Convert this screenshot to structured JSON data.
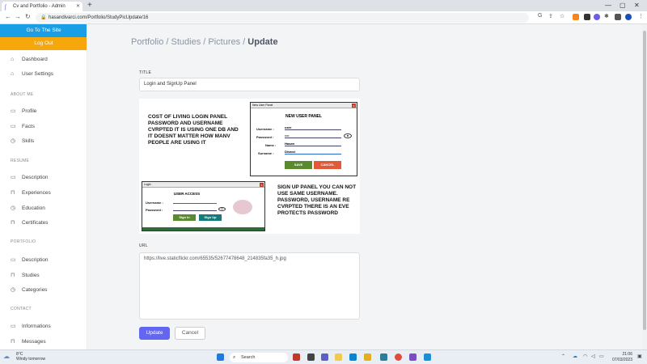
{
  "browser": {
    "tab_title": "Cv and Portfolio - Admin",
    "url": "hasandivarci.com/Portfolio/StudyPicUpdate/16"
  },
  "sidebar": {
    "go_site": "Go To The Site",
    "logout": "Log Out",
    "items_top": [
      {
        "label": "Dashboard",
        "icon": "home-icon"
      },
      {
        "label": "User Settings",
        "icon": "home-icon"
      }
    ],
    "about_head": "ABOUT ME",
    "about_items": [
      {
        "label": "Profile",
        "icon": "calendar-icon"
      },
      {
        "label": "Facts",
        "icon": "calendar-icon"
      },
      {
        "label": "Skills",
        "icon": "clock-icon"
      }
    ],
    "resume_head": "RESUME",
    "resume_items": [
      {
        "label": "Description",
        "icon": "calendar-icon"
      },
      {
        "label": "Experiences",
        "icon": "lock-icon"
      },
      {
        "label": "Education",
        "icon": "clock-icon"
      },
      {
        "label": "Certificates",
        "icon": "lock-icon"
      }
    ],
    "portfolio_head": "PORTFOLIO",
    "portfolio_items": [
      {
        "label": "Description",
        "icon": "calendar-icon"
      },
      {
        "label": "Studies",
        "icon": "lock-icon"
      },
      {
        "label": "Categories",
        "icon": "clock-icon"
      }
    ],
    "contact_head": "CONTACT",
    "contact_items": [
      {
        "label": "Informations",
        "icon": "calendar-icon"
      },
      {
        "label": "Messages",
        "icon": "lock-icon"
      }
    ]
  },
  "breadcrumb": {
    "path": "Portfolio / Studies / Pictures / ",
    "current": "Update"
  },
  "form": {
    "title_label": "TITLE",
    "title_value": "Login and SignUp Panel",
    "url_label": "URL",
    "url_value": "https://live.staticflickr.com/65535/52677478648_214835fa35_h.jpg",
    "update_label": "Update",
    "cancel_label": "Cancel"
  },
  "picture": {
    "text_top": "COST OF LIVING LOGIN PANEL PASSWORD AND USERNAME CVRPTED IT IS USING ONE DB AND IT DOESNT MATTER HOW MANV PEOPLE ARE USING IT",
    "text_bottom": "SIGN UP PANEL YOU CAN NOT USE SAME USERNAME. PASSWORD, USERNAME RE CVRPTED THERE IS AN EVE PROTECTS PASSWORD",
    "newuser_window_title": "New User Panel",
    "newuser_heading": "NEW USER PANEL",
    "nu_username_label": "Username :",
    "nu_username_value": "user",
    "nu_password_label": "Password :",
    "nu_password_value": "••••",
    "nu_name_label": "Name :",
    "nu_name_value": "Hasan",
    "nu_surname_label": "Surname :",
    "nu_surname_value": "Divarci",
    "nu_save": "SAVE",
    "nu_cancel": "CANCEL",
    "login_window_title": "Login",
    "login_heading": "USER ACCESS",
    "lg_username_label": "Username :",
    "lg_password_label": "Password :",
    "lg_signin": "Sign In",
    "lg_signup": "Sign Up"
  },
  "taskbar": {
    "weather_temp": "8°C",
    "weather_desc": "Windy tomorrow",
    "search": "Search",
    "time": "21:06",
    "date": "07/03/2023"
  }
}
